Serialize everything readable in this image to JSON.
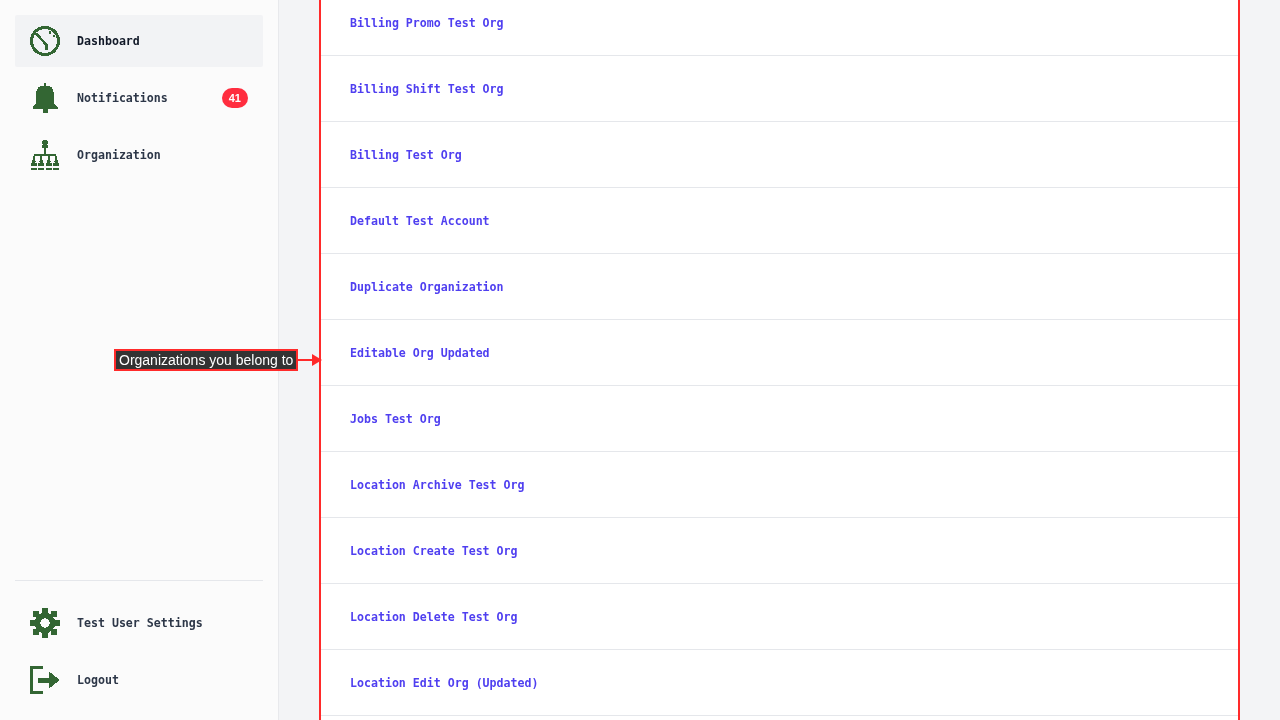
{
  "sidebar": {
    "items": [
      {
        "label": "Dashboard",
        "selected": true
      },
      {
        "label": "Notifications",
        "selected": false,
        "badge": "41"
      },
      {
        "label": "Organization",
        "selected": false
      }
    ],
    "footer_items": [
      {
        "label": "Test User Settings",
        "selected": false
      },
      {
        "label": "Logout",
        "selected": false
      }
    ]
  },
  "organizations": {
    "items": [
      "Billing Promo Test Org",
      "Billing Shift Test Org",
      "Billing Test Org",
      "Default Test Account",
      "Duplicate Organization",
      "Editable Org Updated",
      "Jobs Test Org",
      "Location Archive Test Org",
      "Location Create Test Org",
      "Location Delete Test Org",
      "Location Edit Org (Updated)"
    ]
  },
  "annotation": {
    "label": "Organizations you belong to"
  }
}
